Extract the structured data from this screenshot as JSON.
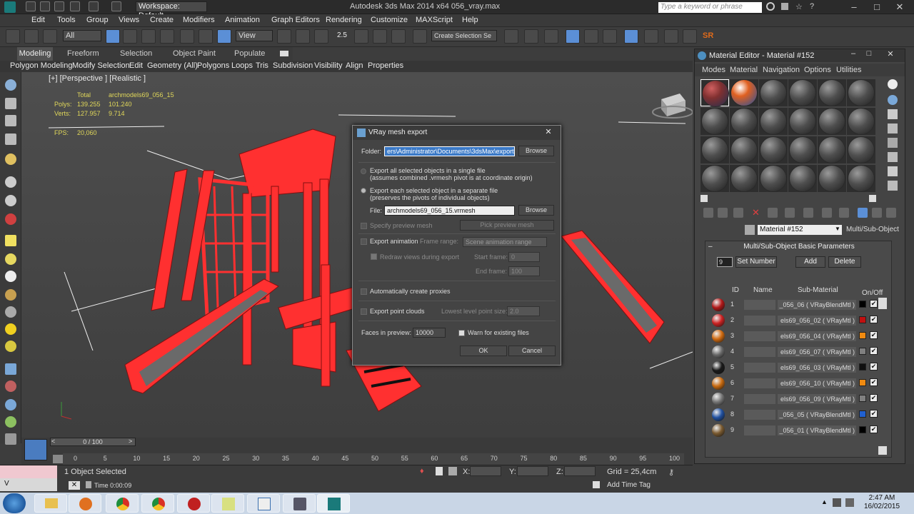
{
  "titlebar": {
    "workspace": "Workspace: Default",
    "app_title": "Autodesk 3ds Max  2014 x64    056_vray.max",
    "search_placeholder": "Type a keyword or phrase"
  },
  "menu": [
    "Edit",
    "Tools",
    "Group",
    "Views",
    "Create",
    "Modifiers",
    "Animation",
    "Graph Editors",
    "Rendering",
    "Customize",
    "MAXScript",
    "Help"
  ],
  "toolbar": {
    "selection_filter": "All",
    "ref_coord": "View",
    "named_selection": "Create Selection Se",
    "snap_value": "2.5"
  },
  "ribbon": {
    "tabs": [
      "Modeling",
      "Freeform",
      "Selection",
      "Object Paint",
      "Populate"
    ],
    "subtabs": [
      "Polygon Modeling",
      "Modify Selection",
      "Edit",
      "Geometry (All)",
      "Polygons",
      "Loops",
      "Tris",
      "Subdivision",
      "Visibility",
      "Align",
      "Properties"
    ]
  },
  "viewport": {
    "label": "[+] [Perspective ] [Realistic ]",
    "stats": {
      "total_label": "Total",
      "object_name": "archmodels69_056_15",
      "polys_label": "Polys:",
      "polys_total": "139.255",
      "polys_obj": "101.240",
      "verts_label": "Verts:",
      "verts_total": "127.957",
      "verts_obj": "9.714",
      "fps_label": "FPS:",
      "fps": "20,060"
    }
  },
  "material_editor": {
    "title": "Material Editor - Material #152",
    "menu": [
      "Modes",
      "Material",
      "Navigation",
      "Options",
      "Utilities"
    ],
    "material_name": "Material #152",
    "material_type": "Multi/Sub-Object",
    "rollout_title": "Multi/Sub-Object Basic Parameters",
    "num_materials": "9",
    "set_number_label": "Set Number",
    "add_label": "Add",
    "delete_label": "Delete",
    "col_id": "ID",
    "col_name": "Name",
    "col_sub": "Sub-Material",
    "col_onoff": "On/Off",
    "rows": [
      {
        "id": "1",
        "sub": "_056_06  ( VRayBlendMtl )",
        "color": "#000000",
        "swatch": "#b01818"
      },
      {
        "id": "2",
        "sub": "els69_056_02  ( VRayMtl )",
        "color": "#c01010",
        "swatch": "#cc2222"
      },
      {
        "id": "3",
        "sub": "els69_056_04  ( VRayMtl )",
        "color": "#f08a10",
        "swatch": "#d06a10"
      },
      {
        "id": "4",
        "sub": "els69_056_07  ( VRayMtl )",
        "color": "#808080",
        "swatch": "#6a6a6a"
      },
      {
        "id": "5",
        "sub": "els69_056_03  ( VRayMtl )",
        "color": "#101010",
        "swatch": "#1a1a1a"
      },
      {
        "id": "6",
        "sub": "els69_056_10  ( VRayMtl )",
        "color": "#f08a10",
        "swatch": "#c86a10"
      },
      {
        "id": "7",
        "sub": "els69_056_09  ( VRayMtl )",
        "color": "#808080",
        "swatch": "#777777"
      },
      {
        "id": "8",
        "sub": "_056_05  ( VRayBlendMtl )",
        "color": "#2060d0",
        "swatch": "#2050a0"
      },
      {
        "id": "9",
        "sub": "_056_01  ( VRayBlendMtl )",
        "color": "#000000",
        "swatch": "#7a5a30"
      }
    ]
  },
  "dialog": {
    "title": "VRay mesh export",
    "folder_label": "Folder:",
    "folder_value": "ers\\Administrator\\Documents\\3dsMax\\export",
    "browse": "Browse",
    "opt1": "Export all selected objects in a single file",
    "opt1_sub": "(assumes combined .vrmesh pivot is at coordinate origin)",
    "opt2": "Export each selected object in a separate file",
    "opt2_sub": "(preserves the pivots of individual objects)",
    "file_label": "File:",
    "file_value": "archmodels69_056_15.vrmesh",
    "specify_preview": "Specify preview mesh",
    "pick_preview": "Pick preview mesh",
    "export_anim": "Export animation",
    "frame_range_label": "Frame range:",
    "frame_range_value": "Scene animation range",
    "redraw": "Redraw views during export",
    "start_frame_label": "Start frame:",
    "start_frame": "0",
    "end_frame_label": "End frame:",
    "end_frame": "100",
    "auto_proxies": "Automatically create proxies",
    "export_clouds": "Export point clouds",
    "lowest_level_label": "Lowest level point size:",
    "lowest_level": "2.0",
    "faces_label": "Faces in preview:",
    "faces_value": "10000",
    "warn_existing": "Warn for existing files",
    "ok": "OK",
    "cancel": "Cancel"
  },
  "timeline": {
    "frame_slider": "0 / 100",
    "ticks": [
      "0",
      "5",
      "10",
      "15",
      "20",
      "25",
      "30",
      "35",
      "40",
      "45",
      "50",
      "55",
      "60",
      "65",
      "70",
      "75",
      "80",
      "85",
      "90",
      "95",
      "100"
    ]
  },
  "status": {
    "selected": "1 Object Selected",
    "x_label": "X:",
    "y_label": "Y:",
    "z_label": "Z:",
    "grid": "Grid = 25,4cm",
    "add_time_tag": "Add Time Tag",
    "time": "Time  0:00:09",
    "listener_label": "V"
  },
  "taskbar": {
    "time": "2:47 AM",
    "date": "16/02/2015"
  }
}
